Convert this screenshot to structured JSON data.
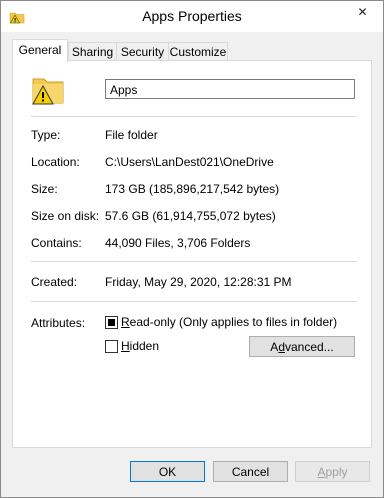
{
  "window": {
    "title": "Apps Properties",
    "close_glyph": "✕"
  },
  "tabs": [
    {
      "label": "General",
      "active": true
    },
    {
      "label": "Sharing",
      "active": false
    },
    {
      "label": "Security",
      "active": false
    },
    {
      "label": "Customize",
      "active": false
    }
  ],
  "general": {
    "name_value": "Apps",
    "rows": {
      "type": {
        "label": "Type:",
        "value": "File folder"
      },
      "location": {
        "label": "Location:",
        "value": "C:\\Users\\LanDest021\\OneDrive"
      },
      "size": {
        "label": "Size:",
        "value": "173 GB (185,896,217,542 bytes)"
      },
      "size_on_disk": {
        "label": "Size on disk:",
        "value": "57.6 GB (61,914,755,072 bytes)"
      },
      "contains": {
        "label": "Contains:",
        "value": "44,090 Files, 3,706 Folders"
      },
      "created": {
        "label": "Created:",
        "value": "Friday, May 29, 2020, 12:28:31 PM"
      }
    },
    "attributes": {
      "label": "Attributes:",
      "readonly": {
        "label_accel": "R",
        "label_rest": "ead-only (Only applies to files in folder)",
        "state": "indeterminate"
      },
      "hidden": {
        "label_accel": "H",
        "label_rest": "idden",
        "state": "unchecked"
      },
      "advanced": {
        "label_pre": "A",
        "label_accel": "d",
        "label_rest": "vanced..."
      }
    }
  },
  "buttons": {
    "ok": "OK",
    "cancel": "Cancel",
    "apply_accel": "A",
    "apply_rest": "pply"
  },
  "colors": {
    "folder_yellow": "#f2c94c",
    "warning_yellow": "#f5d000",
    "focus_blue": "#0078d7"
  }
}
